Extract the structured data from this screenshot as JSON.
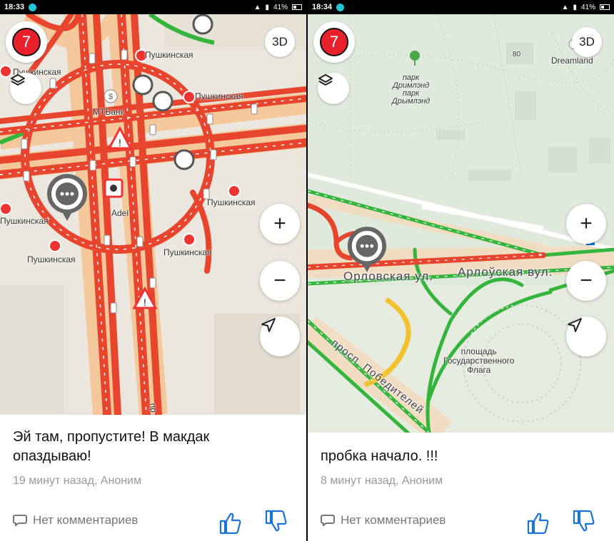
{
  "colors": {
    "traffic_red": "#e8452f",
    "traffic_green": "#33b53b",
    "traffic_yellow": "#f2c12e",
    "map_bg_left": "#ece7de",
    "map_bg_right": "#dfe9dc",
    "accent_blue": "#1a73d9"
  },
  "left": {
    "status": {
      "time": "18:33",
      "battery": "41%"
    },
    "badge_number": "7",
    "btn_3d": "3D",
    "map_labels": {
      "metro1": "Пушкинская",
      "metro2": "Пушкинская",
      "metro3": "Пушкинская",
      "metro4": "Пушкинская",
      "metro5": "Пушкинская",
      "metro6": "Пушкинская",
      "bank": "МТБанк",
      "shop": "Adel",
      "road_letter": "пр"
    },
    "card": {
      "message": "Эй там, пропустите! В макдак опаздываю!",
      "meta": "19 минут назад, Аноним",
      "comments": "Нет комментариев"
    }
  },
  "right": {
    "status": {
      "time": "18:34",
      "battery": "41%"
    },
    "badge_number": "7",
    "btn_3d": "3D",
    "map_labels": {
      "park": "парк\nДримлэнд\nпарк\nДрымлэнд",
      "dreamland": "Dreamland",
      "house_no": "80",
      "street1": "Орловская ул.",
      "street2": "Арлоўская вул.",
      "street3": "просп. Победителей",
      "square": "площадь\nГосударственного\nФлага"
    },
    "card": {
      "message": "пробка начало. !!!",
      "meta": "8 минут назад, Аноним",
      "comments": "Нет комментариев"
    }
  },
  "icons": {
    "layers": "layers-icon",
    "plus": "zoom-in-icon",
    "minus": "zoom-out-icon",
    "locate": "locate-arrow-icon",
    "comment": "comment-icon",
    "like": "thumbs-up-icon",
    "dislike": "thumbs-down-icon",
    "chat_pin": "chat-pin-icon"
  }
}
